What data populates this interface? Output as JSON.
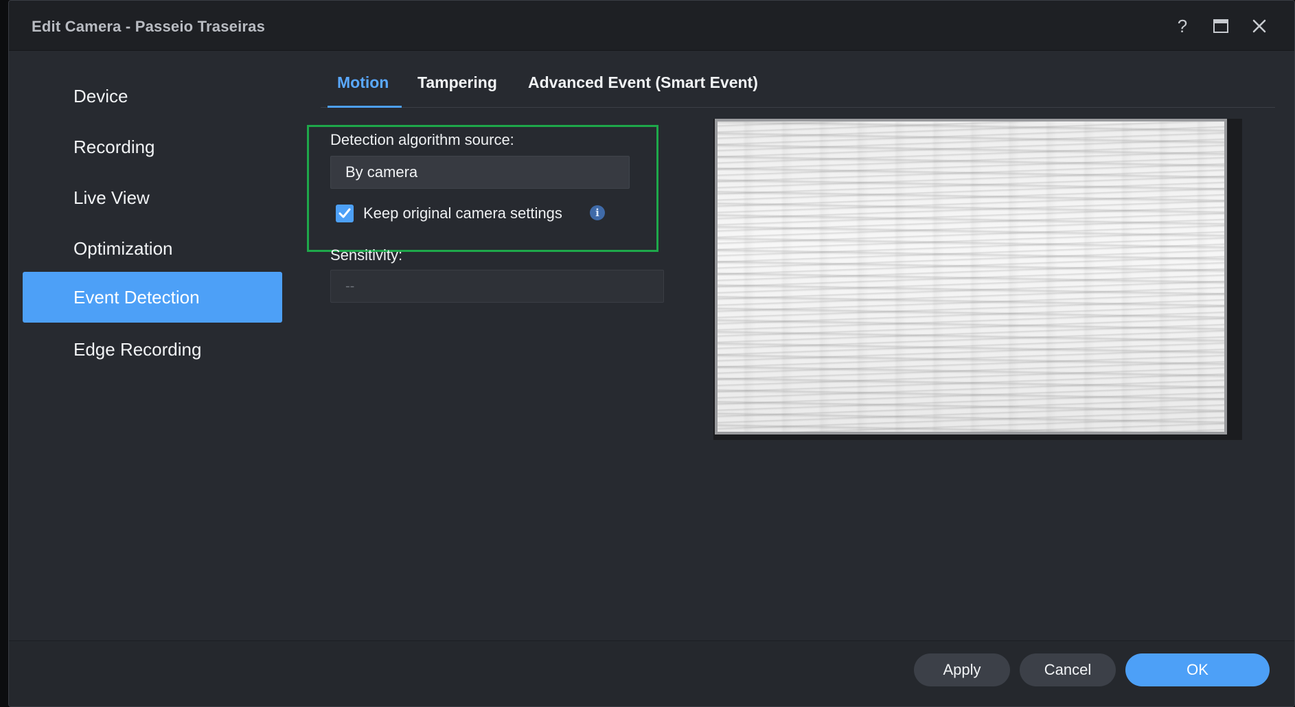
{
  "window": {
    "title": "Edit Camera - Passeio Traseiras",
    "help_glyph": "?",
    "maximize_glyph": "🗖",
    "close_glyph": "✕"
  },
  "sidebar": {
    "items": [
      {
        "label": "Device",
        "active": false
      },
      {
        "label": "Recording",
        "active": false
      },
      {
        "label": "Live View",
        "active": false
      },
      {
        "label": "Optimization",
        "active": false
      },
      {
        "label": "Event Detection",
        "active": true
      },
      {
        "label": "Edge Recording",
        "active": false
      }
    ]
  },
  "tabs": [
    {
      "label": "Motion",
      "active": true
    },
    {
      "label": "Tampering",
      "active": false
    },
    {
      "label": "Advanced Event (Smart Event)",
      "active": false
    }
  ],
  "motion": {
    "detection_source_label": "Detection algorithm source:",
    "detection_source_value": "By camera",
    "keep_original_label": "Keep original camera settings",
    "keep_original_checked": true,
    "info_glyph": "i",
    "sensitivity_label": "Sensitivity:",
    "sensitivity_value": "--"
  },
  "footer": {
    "apply_label": "Apply",
    "cancel_label": "Cancel",
    "ok_label": "OK"
  },
  "colors": {
    "accent": "#4da0f7",
    "highlight": "#1ea84a",
    "background": "#272a30"
  }
}
